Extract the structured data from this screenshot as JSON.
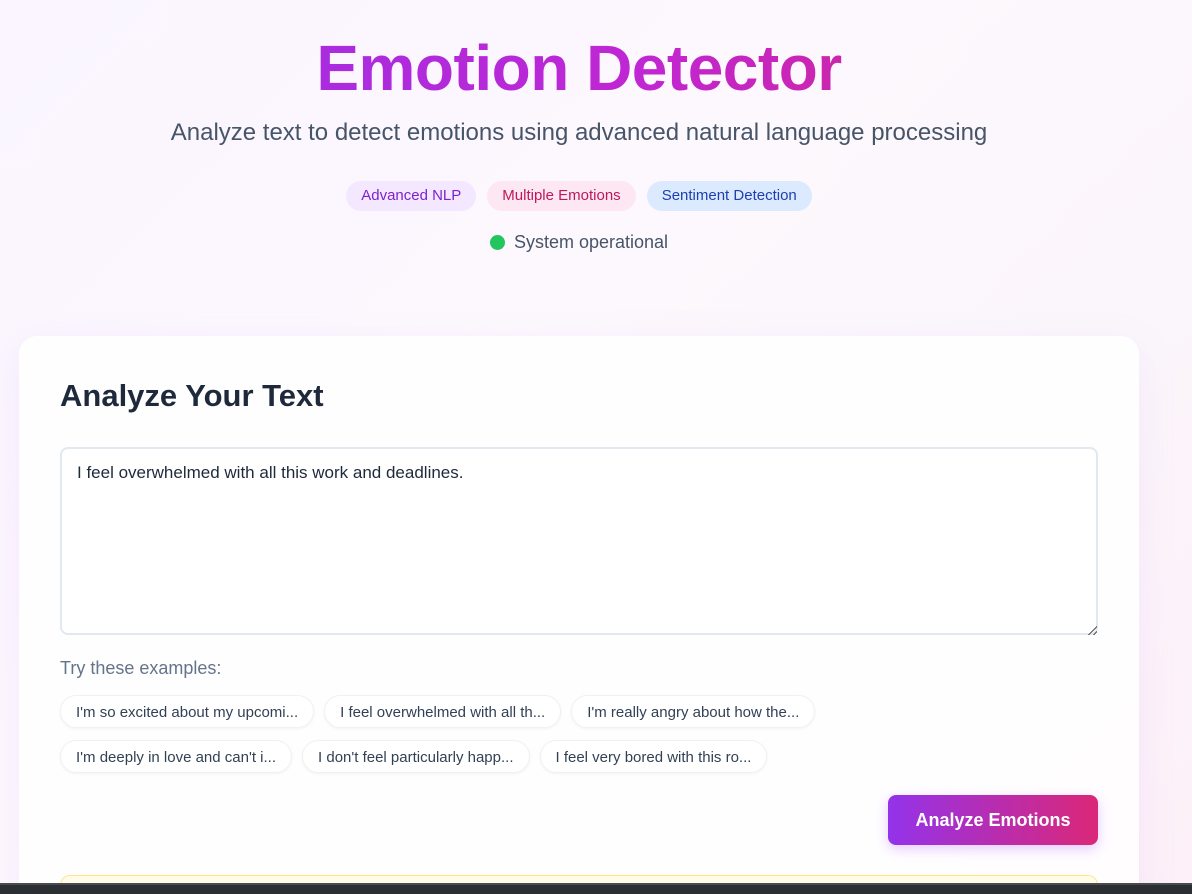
{
  "header": {
    "title": "Emotion Detector",
    "subtitle": "Analyze text to detect emotions using advanced natural language processing",
    "badges": [
      "Advanced NLP",
      "Multiple Emotions",
      "Sentiment Detection"
    ],
    "status": "System operational"
  },
  "analyzer": {
    "title": "Analyze Your Text",
    "input_value": "I feel overwhelmed with all this work and deadlines.",
    "examples_label": "Try these examples:",
    "examples": [
      "I'm so excited about my upcomi...",
      "I feel overwhelmed with all th...",
      "I'm really angry about how the...",
      "I'm deeply in love and can't i...",
      "I don't feel particularly happ...",
      "I feel very bored with this ro..."
    ],
    "analyze_label": "Analyze Emotions"
  },
  "colors": {
    "accent_start": "#9333ea",
    "accent_end": "#db2777",
    "status_ok": "#22c55e"
  }
}
